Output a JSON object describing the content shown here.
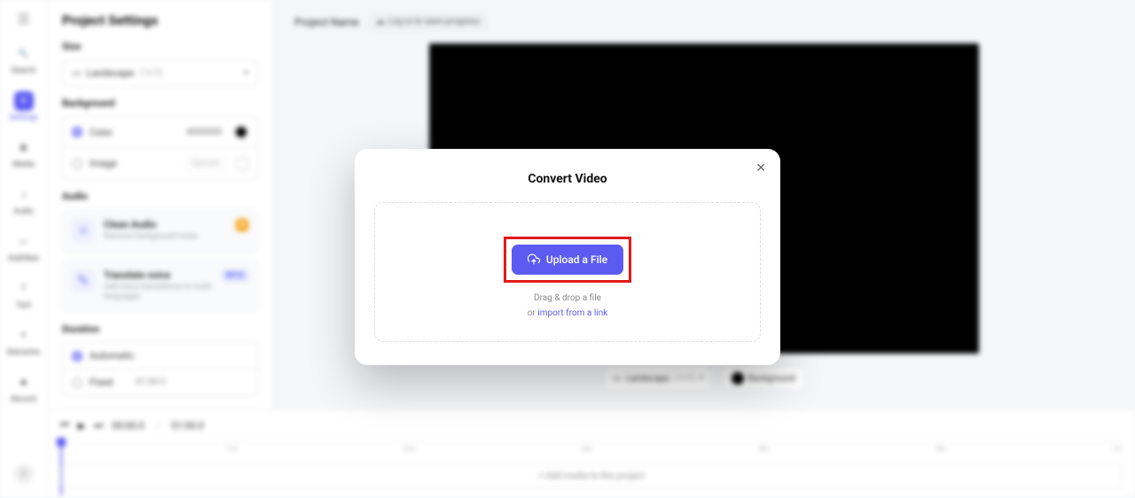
{
  "leftbar": {
    "items": [
      {
        "key": "search",
        "label": "Search"
      },
      {
        "key": "settings",
        "label": "Settings",
        "active": true
      },
      {
        "key": "media",
        "label": "Media"
      },
      {
        "key": "audio",
        "label": "Audio"
      },
      {
        "key": "subtitles",
        "label": "Subtitles"
      },
      {
        "key": "text",
        "label": "Text"
      },
      {
        "key": "elements",
        "label": "Elements"
      },
      {
        "key": "record",
        "label": "Record"
      }
    ],
    "help": "?"
  },
  "sidebar": {
    "title": "Project Settings",
    "size": {
      "label": "Size",
      "selected": "Landscape",
      "ratio": "(16:9)"
    },
    "background": {
      "label": "Background",
      "color_label": "Color",
      "hex": "#000000",
      "image_label": "Image",
      "upload_label": "Upload"
    },
    "audio": {
      "label": "Audio",
      "clean_title": "Clean Audio",
      "clean_sub": "Remove background noise",
      "translate_title": "Translate voice",
      "translate_sub": "Add voice translations in multi-languages",
      "beta_badge": "BETA",
      "gem_badge": "◆"
    },
    "duration": {
      "label": "Duration",
      "auto_label": "Automatic",
      "fixed_label": "Fixed",
      "fixed_time": "01:00.0"
    }
  },
  "canvas": {
    "project_name": "Project Name",
    "login_hint": "Log in to save progress",
    "landscape_pill": "Landscape",
    "landscape_ratio": "(16:9)",
    "bg_pill": "Background"
  },
  "timeline": {
    "current": "00:00.0",
    "total": "01:00.0",
    "marks": [
      "",
      "10s",
      "20s",
      "30s",
      "40s",
      "50s",
      "1m"
    ],
    "track_prompt": "+  Add media to this project"
  },
  "modal": {
    "title": "Convert Video",
    "cta": "Upload a File",
    "hint_drag": "Drag & drop a file",
    "hint_or": "or ",
    "hint_link": "import from a link"
  }
}
